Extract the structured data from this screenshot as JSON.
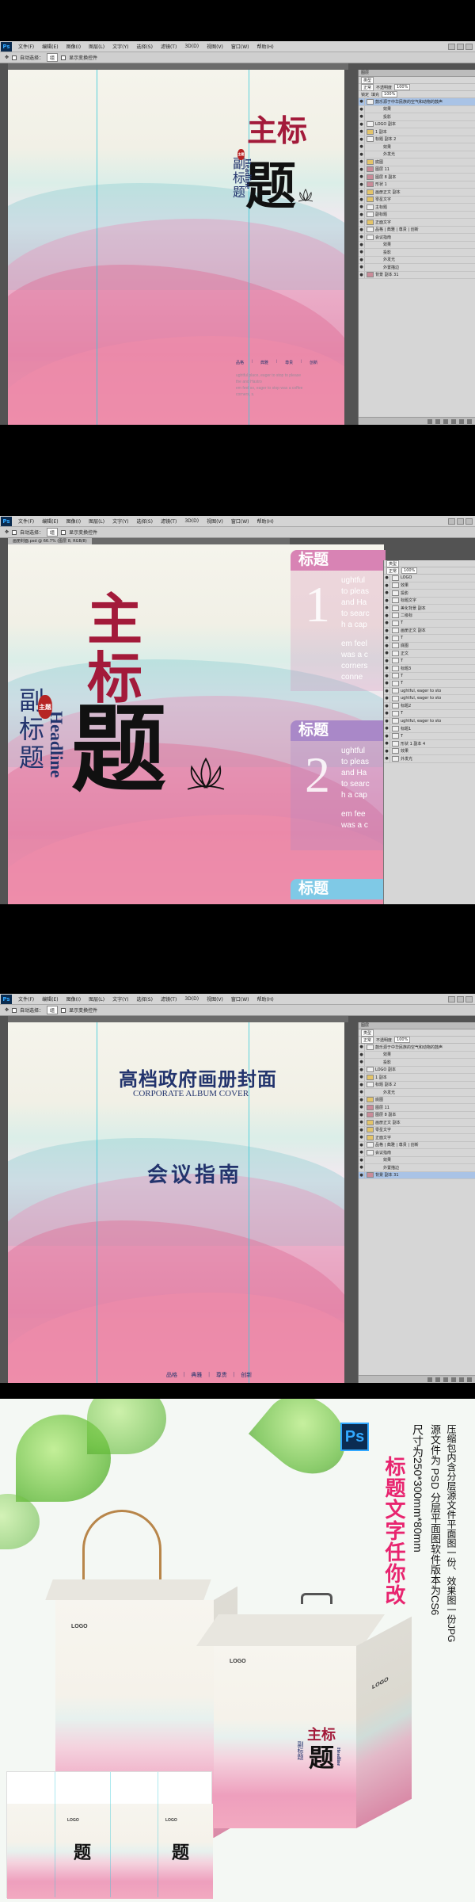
{
  "ps": {
    "logo": "Ps",
    "menu": [
      "文件(F)",
      "编辑(E)",
      "图像(I)",
      "图层(L)",
      "文字(Y)",
      "选择(S)",
      "滤镜(T)",
      "3D(D)",
      "视图(V)",
      "窗口(W)",
      "帮助(H)"
    ],
    "options": {
      "auto_select": "自动选择：",
      "target": "组",
      "transform": "显示变换控件"
    },
    "layers_panel": {
      "title": "图层",
      "kind": "类型",
      "blend": "正常",
      "opacity_label": "不透明度",
      "opacity": "100%",
      "lock": "锁定",
      "fill_label": "填充",
      "fill": "100%"
    }
  },
  "screen1": {
    "layers": [
      {
        "name": "鼓乐源于中华民族的空气和动物的鼓声",
        "type": "T",
        "selected": true
      },
      {
        "name": "效果",
        "type": "fx"
      },
      {
        "name": "投影",
        "type": "fx"
      },
      {
        "name": "LOGO 副本",
        "type": "T"
      },
      {
        "name": "1 副本",
        "type": "group"
      },
      {
        "name": "标题 副本 2",
        "type": "T"
      },
      {
        "name": "效果",
        "type": "fx"
      },
      {
        "name": "外发光",
        "type": "fx"
      },
      {
        "name": "底图",
        "type": "group"
      },
      {
        "name": "图层 11",
        "type": "img"
      },
      {
        "name": "图层 8 副本",
        "type": "img"
      },
      {
        "name": "形状 1",
        "type": "img"
      },
      {
        "name": "画册正文 副本",
        "type": "group"
      },
      {
        "name": "零星文字",
        "type": "group"
      },
      {
        "name": "主标题",
        "type": "T"
      },
      {
        "name": "副标题",
        "type": "T"
      },
      {
        "name": "正面文字",
        "type": "group"
      },
      {
        "name": "品格 | 典雅 | 尊贵 | 创新",
        "type": "T"
      },
      {
        "name": "会议指南",
        "type": "T"
      },
      {
        "name": "效果",
        "type": "fx"
      },
      {
        "name": "投影",
        "type": "fx"
      },
      {
        "name": "外发光",
        "type": "fx"
      },
      {
        "name": "外置描边",
        "type": "fx"
      },
      {
        "name": "背景 副本 31",
        "type": "img"
      }
    ],
    "cover": {
      "main_title": [
        "主",
        "标"
      ],
      "ti_char": "题",
      "subtitle": "副标题",
      "headline": "Headline",
      "seal": "主题",
      "tags": [
        "品格",
        "典雅",
        "尊贵",
        "创新"
      ],
      "fine_text": [
        "ughtful place, eager to stop to please the and Hastro",
        "em feel so, eager to stop was a coffee corners, s."
      ]
    }
  },
  "screen2": {
    "tab_title": "画册封面.psd @ 66.7% (图层 8, RGB/8)",
    "cover": {
      "main_title": [
        "主",
        "标"
      ],
      "ti_char": "题",
      "subtitle": "副标题",
      "headline": "Headline",
      "seal": "主题"
    },
    "cards": [
      {
        "title": "标题",
        "number": "1",
        "lines": [
          "ughtful",
          "to pleas",
          "and Ha",
          "to searc",
          "h a cap",
          "",
          "em feel",
          "was a c",
          "corners",
          "conne"
        ],
        "color": "#d883b4"
      },
      {
        "title": "标题",
        "number": "2",
        "lines": [
          "ughtful",
          "to pleas",
          "and Ha",
          "to searc",
          "h a cap",
          "",
          "em fee",
          "was a c"
        ],
        "color": "#a988c8"
      },
      {
        "title": "标题",
        "number": "3",
        "lines": [],
        "color": "#7fc9e6"
      }
    ],
    "layers": [
      "LOGO",
      "效果",
      "投影",
      "标题文字",
      "美化背景 副本",
      "二级标",
      "T",
      "画册正文 副本",
      "T",
      "底图",
      "正文",
      "T",
      "标题3",
      "T",
      "T",
      "ughtful, eager to sto",
      "ughtful, eager to sto",
      "标题2",
      "T",
      "ughtful, eager to sto",
      "标题1",
      "T",
      "形状 1 副本 4",
      "效果",
      "外发光"
    ]
  },
  "screen3": {
    "title": "高档政府画册封面",
    "title_en": "CORPORATE ALBUM COVER",
    "heading": "会议指南",
    "tags": [
      "品格",
      "典雅",
      "尊贵",
      "创新"
    ],
    "layers": [
      {
        "name": "鼓乐源于中华民族的空气和动物的鼓声",
        "type": "T"
      },
      {
        "name": "效果",
        "type": "fx"
      },
      {
        "name": "投影",
        "type": "fx"
      },
      {
        "name": "LOGO 副本",
        "type": "T"
      },
      {
        "name": "1 副本",
        "type": "group"
      },
      {
        "name": "标题 副本 2",
        "type": "T"
      },
      {
        "name": "外发光",
        "type": "fx"
      },
      {
        "name": "底图",
        "type": "group"
      },
      {
        "name": "图层 11",
        "type": "img"
      },
      {
        "name": "图层 8 副本",
        "type": "img"
      },
      {
        "name": "画册正文 副本",
        "type": "group"
      },
      {
        "name": "零星文字",
        "type": "group"
      },
      {
        "name": "正面文字",
        "type": "group"
      },
      {
        "name": "品格 | 典雅 | 尊贵 | 创新",
        "type": "T"
      },
      {
        "name": "会议指南",
        "type": "T"
      },
      {
        "name": "效果",
        "type": "fx"
      },
      {
        "name": "外置描边",
        "type": "fx"
      },
      {
        "name": "背景 副本 31",
        "type": "img",
        "selected": true
      }
    ]
  },
  "promo": {
    "badge": "Ps",
    "headline": "标题文字任你改",
    "line1": "压缩包内含分层源文件平面图一份、效果图一份JPG",
    "line2": "源文件为 PSD  分层平面图软件版本为CS6",
    "line3": "尺寸为250*300mm*80mm",
    "bag_logo": "LOGO",
    "bag_main": [
      "主",
      "标"
    ],
    "bag_ti": "题",
    "bag_sub": "副标题",
    "bag_headline": "Headline",
    "mini_logos": [
      "LOGO",
      "LOGO"
    ]
  },
  "colors": {
    "accent_red": "#a31a3a",
    "navy": "#23346d",
    "ps_gray": "#535353",
    "cyan_guide": "#35c8d8"
  }
}
